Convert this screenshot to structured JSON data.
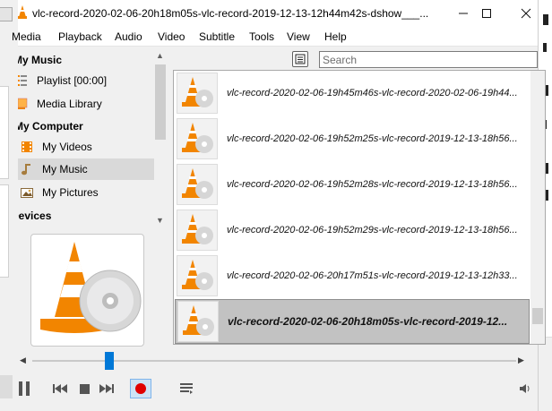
{
  "window": {
    "title": "vlc-record-2020-02-06-20h18m05s-vlc-record-2019-12-13-12h44m42s-dshow___..."
  },
  "menu": {
    "items": [
      "Media",
      "Playback",
      "Audio",
      "Video",
      "Subtitle",
      "Tools",
      "View",
      "Help"
    ]
  },
  "sidebar": {
    "sections": [
      {
        "title": "My Music"
      },
      {
        "title": "My Computer"
      },
      {
        "title": "Devices"
      }
    ],
    "items": [
      {
        "label": "Playlist [00:00]",
        "icon": "playlist-icon"
      },
      {
        "label": "Media Library",
        "icon": "media-library-icon"
      },
      {
        "label": "My Videos",
        "icon": "film-icon"
      },
      {
        "label": "My Music",
        "icon": "music-note-icon"
      },
      {
        "label": "My Pictures",
        "icon": "picture-icon"
      }
    ],
    "selected": "My Music"
  },
  "search": {
    "placeholder": "Search",
    "value": ""
  },
  "playlist": {
    "items": [
      {
        "name": "vlc-record-2020-02-06-19h45m46s-vlc-record-2020-02-06-19h44..."
      },
      {
        "name": "vlc-record-2020-02-06-19h52m25s-vlc-record-2019-12-13-18h56..."
      },
      {
        "name": "vlc-record-2020-02-06-19h52m28s-vlc-record-2019-12-13-18h56..."
      },
      {
        "name": "vlc-record-2020-02-06-19h52m29s-vlc-record-2019-12-13-18h56..."
      },
      {
        "name": "vlc-record-2020-02-06-20h17m51s-vlc-record-2019-12-13-12h33..."
      },
      {
        "name": "vlc-record-2020-02-06-20h18m05s-vlc-record-2019-12..."
      }
    ],
    "selected_index": 5
  },
  "player": {
    "seek_position": 0.16
  },
  "colors": {
    "accent": "#0078d7",
    "selection": "#c2c2c2",
    "record": "#e00000",
    "cone_orange": "#f28500"
  }
}
